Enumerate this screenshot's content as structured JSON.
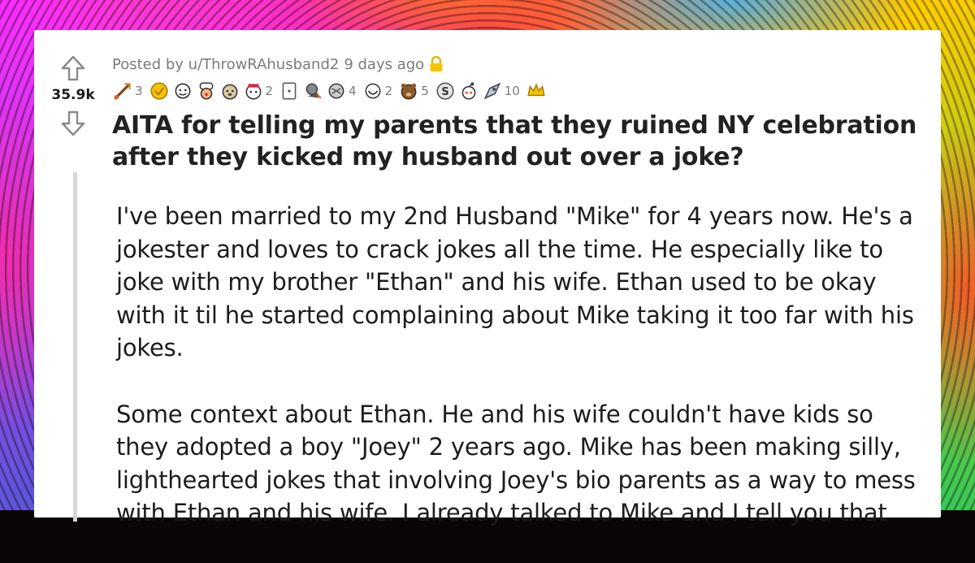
{
  "post": {
    "score": "35.9k",
    "posted_by": "Posted by u/ThrowRAhusband2",
    "age": "9 days ago",
    "title": "AITA for telling my parents that they ruined NY celebration after they kicked my husband out over a joke?",
    "paragraphs": [
      "I've been married to my 2nd Husband \"Mike\" for 4 years now. He's a jokester and loves to crack jokes all the time. He especially like to joke with my brother \"Ethan\" and his wife. Ethan used to be okay with it til he started complaining about Mike taking it too far with his jokes.",
      "Some context about Ethan. He and his wife couldn't have kids so they adopted a boy \"Joey\" 2 years ago. Mike has been making silly, lighthearted jokes that involving Joey's bio parents as a way to mess with Ethan and his wife. I already talked to Mike and I tell you that"
    ]
  },
  "awards": [
    {
      "icon": "sword-award-icon",
      "count": "3"
    },
    {
      "icon": "gold-award-icon",
      "count": ""
    },
    {
      "icon": "wholesome-award-icon",
      "count": ""
    },
    {
      "icon": "chef-kiss-award-icon",
      "count": ""
    },
    {
      "icon": "doge-award-icon",
      "count": ""
    },
    {
      "icon": "helpful-award-icon",
      "count": "2"
    },
    {
      "icon": "card-award-icon",
      "count": ""
    },
    {
      "icon": "facepalm-award-icon",
      "count": ""
    },
    {
      "icon": "mind-blown-award-icon",
      "count": "4"
    },
    {
      "icon": "laugh-award-icon",
      "count": "2"
    },
    {
      "icon": "bear-award-icon",
      "count": "5"
    },
    {
      "icon": "silver-award-icon",
      "count": ""
    },
    {
      "icon": "snoo-award-icon",
      "count": ""
    },
    {
      "icon": "rocket-award-icon",
      "count": "10"
    },
    {
      "icon": "crown-award-icon",
      "count": ""
    }
  ],
  "colors": {
    "card_bg": "#ffffff",
    "meta_text": "#787c7e",
    "title_text": "#222222",
    "body_text": "#1c1c1c",
    "lock_icon": "#e8b600",
    "thread_line": "#d4d6d8"
  }
}
